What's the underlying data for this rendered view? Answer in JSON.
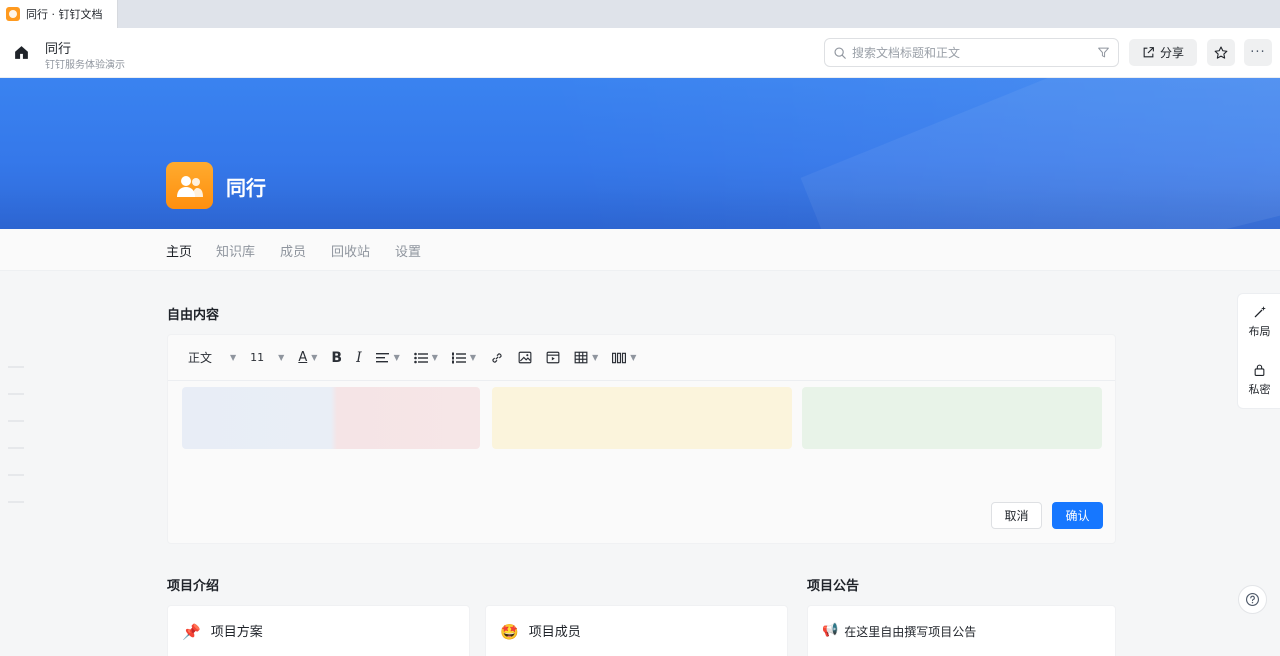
{
  "browser_tab": {
    "title": "同行 · 钉钉文档"
  },
  "header": {
    "title": "同行",
    "subtitle": "钉钉服务体验演示",
    "search_placeholder": "搜索文档标题和正文",
    "share_label": "分享",
    "more_label": "···"
  },
  "banner": {
    "space_name": "同行"
  },
  "nav": {
    "items": [
      {
        "label": "主页",
        "active": true
      },
      {
        "label": "知识库",
        "active": false
      },
      {
        "label": "成员",
        "active": false
      },
      {
        "label": "回收站",
        "active": false
      },
      {
        "label": "设置",
        "active": false
      }
    ]
  },
  "free_content": {
    "title": "自由内容",
    "toolbar": {
      "style_select": "正文",
      "font_size": "11",
      "text_color_glyph": "A",
      "bold_glyph": "B",
      "italic_glyph": "I"
    },
    "placeholder_colors": [
      "#e9eef6",
      "#fbf4dc",
      "#e8f3e8"
    ],
    "cancel_label": "取消",
    "confirm_label": "确认"
  },
  "project_intro": {
    "title": "项目介绍",
    "cards": [
      {
        "emoji": "📌",
        "label": "项目方案"
      },
      {
        "emoji": "🤩",
        "label": "项目成员"
      }
    ]
  },
  "project_announcement": {
    "title": "项目公告",
    "emoji": "📢",
    "text": "在这里自由撰写项目公告"
  },
  "side_panel": {
    "layout_label": "布局",
    "private_label": "私密"
  },
  "colors": {
    "accent": "#1677ff",
    "banner": "#3578ea",
    "space_icon": "#ff9a1f"
  }
}
